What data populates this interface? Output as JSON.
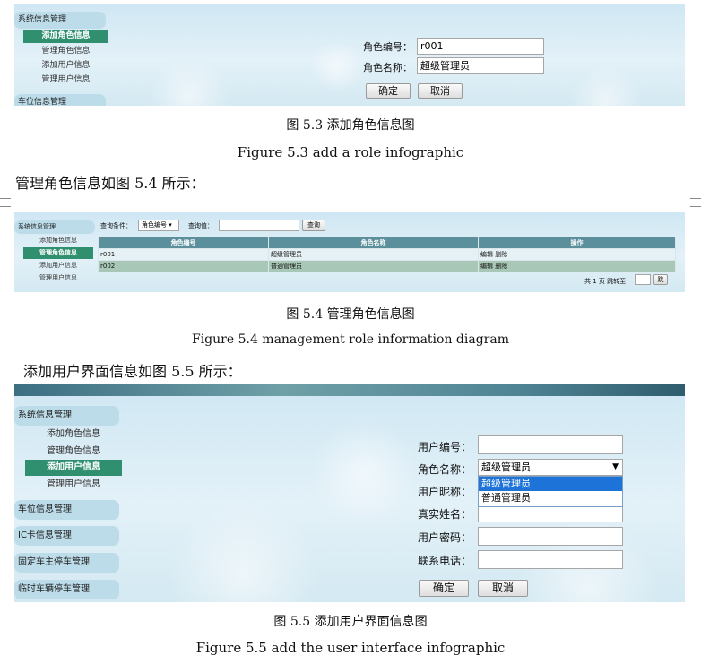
{
  "sidebar": {
    "system_menu": "系统信息管理",
    "add_role": "添加角色信息",
    "manage_role": "管理角色信息",
    "add_user": "添加用户信息",
    "manage_user": "管理用户信息",
    "parking_menu": "车位信息管理",
    "ic_menu": "IC卡信息管理",
    "fixed_menu": "固定车主停车管理",
    "temp_menu": "临时车辆停车管理"
  },
  "fig3": {
    "role_id_label": "角色编号：",
    "role_id_value": "r001",
    "role_name_label": "角色名称：",
    "role_name_value": "超级管理员",
    "ok": "确定",
    "cancel": "取消",
    "caption_cn": "图 5.3 添加角色信息图",
    "caption_en": "Figure 5.3 add a role infographic"
  },
  "para1": "管理角色信息如图 5.4 所示：",
  "fig4": {
    "query_cond_label": "查询条件：",
    "query_cond_value": "角色编号",
    "query_val_label": "查询值：",
    "query_button": "查询",
    "columns": [
      "角色编号",
      "角色名称",
      "操作"
    ],
    "rows": [
      {
        "id": "r001",
        "name": "超级管理员",
        "edit": "编辑",
        "del": "删除"
      },
      {
        "id": "r002",
        "name": "普通管理员",
        "edit": "编辑",
        "del": "删除"
      }
    ],
    "pager_text": "共 1 页 跳转至",
    "pager_go": "跳",
    "caption_cn": "图 5.4 管理角色信息图",
    "caption_en": "Figure 5.4 management role information diagram"
  },
  "para2": "添加用户界面信息如图 5.5 所示：",
  "fig5": {
    "user_id_label": "用户编号：",
    "role_name_label": "角色名称：",
    "role_selected": "超级管理员",
    "role_options": [
      "超级管理员",
      "普通管理员"
    ],
    "nickname_label": "用户昵称：",
    "realname_label": "真实姓名：",
    "password_label": "用户密码：",
    "phone_label": "联系电话：",
    "ok": "确定",
    "cancel": "取消",
    "caption_cn": "图 5.5 添加用户界面信息图",
    "caption_en": "Figure 5.5 add the user interface infographic"
  },
  "colors": {
    "accent": "#2f8f6f",
    "menu": "#bcdce9",
    "table_header": "#5a8f9b",
    "dropdown_selected": "#1e73d8"
  }
}
